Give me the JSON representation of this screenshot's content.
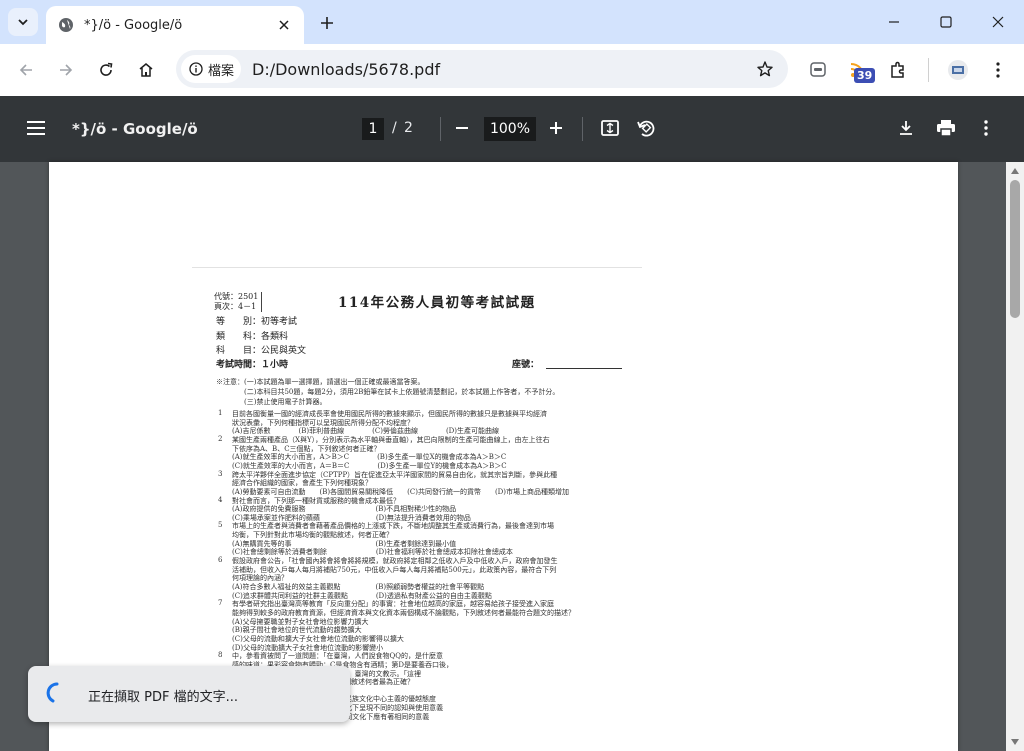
{
  "tab": {
    "title": "*}/ö - Google/ö"
  },
  "omnibox": {
    "chip_label": "檔案",
    "url": "D:/Downloads/5678.pdf"
  },
  "extensions": {
    "badge_count": "39"
  },
  "pdf_toolbar": {
    "title": "*}/ö - Google/ö",
    "current_page": "1",
    "page_separator": "/",
    "total_pages": "2",
    "zoom": "100%"
  },
  "document": {
    "code_line1": "代號：2501",
    "code_line2": "頁次：4－1",
    "exam_title": "114年公務人員初等考試試題",
    "meta": [
      "等　　別：初等考試",
      "類　　科：各類科",
      "科　　目：公民與英文",
      "考試時間：１小時"
    ],
    "seat_label": "座號：",
    "notice_lines": [
      "※注意：(一)本試題為單一選擇題，請選出一個正確或最適當答案。",
      "　　　　(二)本科目共50題，每題2分，須用2B鉛筆在試卡上依題號清楚劃記，於本試題上作答者，不予計分。",
      "　　　　(三)禁止使用電子計算器。"
    ],
    "question_lines": [
      {
        "n": "1",
        "t": "目前各國衡量一國的經濟成長率會使用國民所得的數據來顯示，但國民所得的數據只是數據與平均經濟"
      },
      {
        "n": "",
        "t": "狀況表彙，下列何種指標可以呈現國民所得分配不均程度？"
      },
      {
        "n": "",
        "t": "(A)吉尼係數　　　　(B)菲利普曲線　　　　(C)勞倫茲曲線　　　　(D)生產可能曲線"
      },
      {
        "n": "2",
        "t": "某國生產兩種產品（X與Y），分別表示為水平軸與垂直軸），其巴向限制的生產可能曲線上，由左上往右"
      },
      {
        "n": "",
        "t": "下依序為A、B、C三個點，下列敘述何者正確？"
      },
      {
        "n": "",
        "t": "(A)就生產效率的大小而言，A＞B＞C　　　　(B)多生產一單位X的機會成本為A＞B＞C"
      },
      {
        "n": "",
        "t": "(C)就生產效率的大小而言，A＝B＝C　　　　(D)多生產一單位Y的機會成本為A＞B＞C"
      },
      {
        "n": "3",
        "t": "跨太平洋夥伴全面進步協定（CPTPP）旨在促進亞太平洋國家間的貿易自由化，就其宗旨判斷，參與此種"
      },
      {
        "n": "",
        "t": "經濟合作組織的國家，會產生下列何種現象？"
      },
      {
        "n": "",
        "t": "(A)勞動要素可自由流動　　(B)各國間貿易關稅降低　　(C)共同發行統一的貨幣　　(D)市場上商品種類增加"
      },
      {
        "n": "4",
        "t": "對社會而言，下列那一種財貨或服務的機會成本最低？"
      },
      {
        "n": "",
        "t": "(A)政府提供的免費服務　　　　　　　　　　(B)不具相對稀少性的物品"
      },
      {
        "n": "",
        "t": "(C)乘場承案並作肥料的蘋蘋　　　　　　　　(D)無法提升消費者效用的物品"
      },
      {
        "n": "5",
        "t": "市場上的生產者與消費者會藉著產品價格的上漲或下跌，不斷地調整其生產或消費行為，最後會達到市場"
      },
      {
        "n": "",
        "t": "均衡，下列針對此市場均衡的觀點敘述，何者正確？"
      },
      {
        "n": "",
        "t": "(A)無購買先等的事　　　　　　　　　　　　(B)生產者剩餘達到最小值"
      },
      {
        "n": "",
        "t": "(C)社會總剩餘等於消費者剩餘　　　　　　　(D)社會福利等於社會總成本扣除社會總成本"
      },
      {
        "n": "6",
        "t": "假設政府會公告，「社會國內將會將會將將規模，就政府將定相鄰之低收入戶及中低收入戶，政府會加發生"
      },
      {
        "n": "",
        "t": "活補助，但收入戶每人每月將補貼750元，中低收入戶每人每月將補貼500元」，此政策內容，最符合下列"
      },
      {
        "n": "",
        "t": "何項理論的內涵？"
      },
      {
        "n": "",
        "t": "(A)符合多數人福祉的效益主義觀點　　　　　(B)照顧弱勢者權益的社會平等觀點"
      },
      {
        "n": "",
        "t": "(C)追求群體共同利益的社群主義觀點　　　　(D)透過私有財產公益的自由主義觀點"
      },
      {
        "n": "7",
        "t": "有學者研究指出臺灣高等教育「反向重分配」的事實：社會地位越高的家庭，越容易給孩子接受進入家庭"
      },
      {
        "n": "",
        "t": "能夠得到較多的政府教育資源，但經濟資本與文化資本兩個構成不論觀點，下列敘述何者最能符合題文的描述？"
      },
      {
        "n": "",
        "t": "(A)父母擁要職並對子女社會地位影響力擴大"
      },
      {
        "n": "",
        "t": "(B)親子間社會地位的世代流動的趨勢擴大"
      },
      {
        "n": "",
        "t": "(C)父母的流動和擴大子女社會地位流動的影響得以擴大"
      },
      {
        "n": "",
        "t": "(D)父母的流動擴大子女社會地位流動的影響變小"
      },
      {
        "n": "8",
        "t": "中，參看資被問了一道問題：「在臺灣，人們說食物QQ的，是什麼意"
      },
      {
        "n": "",
        "t": "感的味道；果彩容食物有嚼勁；C是食物含有酒精；第D是要養吞口後，"
      },
      {
        "n": "",
        "t": "與主食擔量的機會」，由在同一般東中，臺灣的文教示。「這裡"
      },
      {
        "n": "",
        "t": "？」對於上述所反映的文化現象，下列敘述何者最為正確？"
      },
      {
        "n": "",
        "t": "的不同處境出無法正確回答"
      },
      {
        "n": "",
        "t": "(A)「QQ」當是很可能的，他在同在民族文化中心主義的優越態度"
      },
      {
        "n": "",
        "t": "(B)「QQ」作為一種用則，在不同文化下呈現不同的認知與使用意義"
      },
      {
        "n": "",
        "t": "(C)參賽者自設計者認為「QQ」在不同文化下應有著相同的意義"
      }
    ]
  },
  "toast": {
    "message": "正在擷取 PDF 檔的文字..."
  }
}
